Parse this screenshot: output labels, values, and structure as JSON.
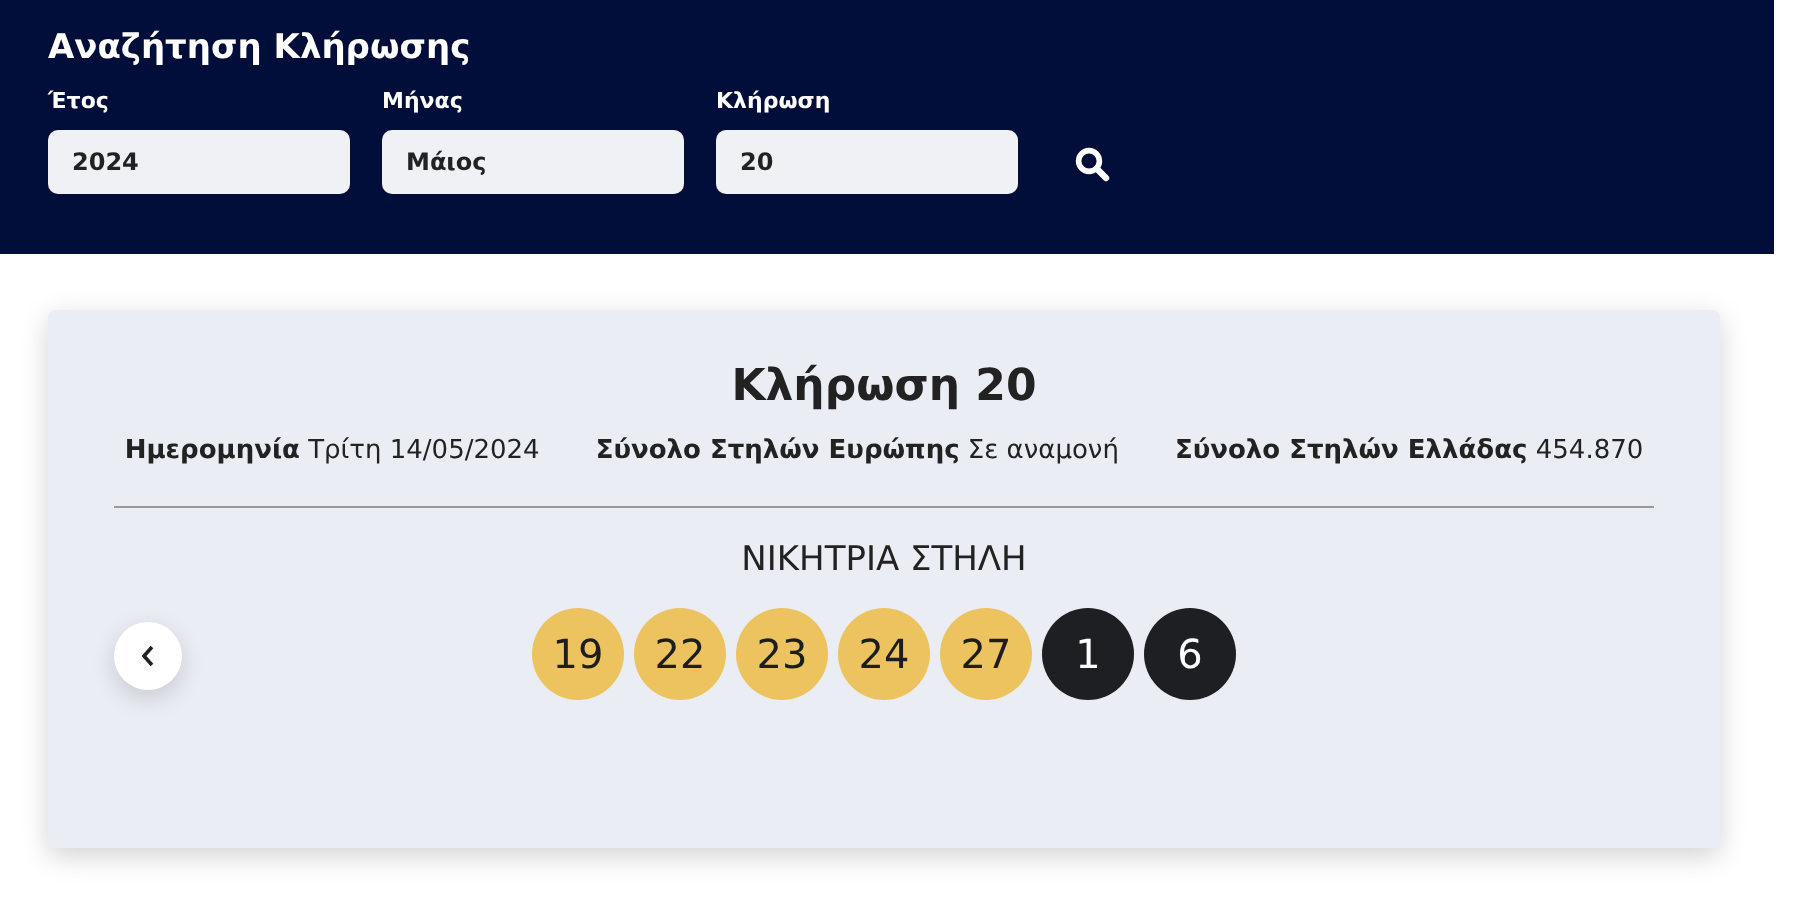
{
  "search": {
    "title": "Αναζήτηση Κλήρωσης",
    "fields": [
      {
        "label": "Έτος",
        "value": "2024"
      },
      {
        "label": "Μήνας",
        "value": "Μάιος"
      },
      {
        "label": "Κλήρωση",
        "value": "20"
      }
    ]
  },
  "draw": {
    "title": "Κλήρωση 20",
    "stats": [
      {
        "label": "Ημερομηνία",
        "value": "Τρίτη 14/05/2024"
      },
      {
        "label": "Σύνολο Στηλών Ευρώπης",
        "value": "Σε αναμονή"
      },
      {
        "label": "Σύνολο Στηλών Ελλάδας",
        "value": "454.870"
      }
    ],
    "winning_heading": "ΝΙΚΗΤΡΙΑ ΣΤΗΛΗ",
    "balls": [
      {
        "number": "19",
        "kind": "main"
      },
      {
        "number": "22",
        "kind": "main"
      },
      {
        "number": "23",
        "kind": "main"
      },
      {
        "number": "24",
        "kind": "main"
      },
      {
        "number": "27",
        "kind": "main"
      },
      {
        "number": "1",
        "kind": "bonus"
      },
      {
        "number": "6",
        "kind": "bonus"
      }
    ]
  }
}
